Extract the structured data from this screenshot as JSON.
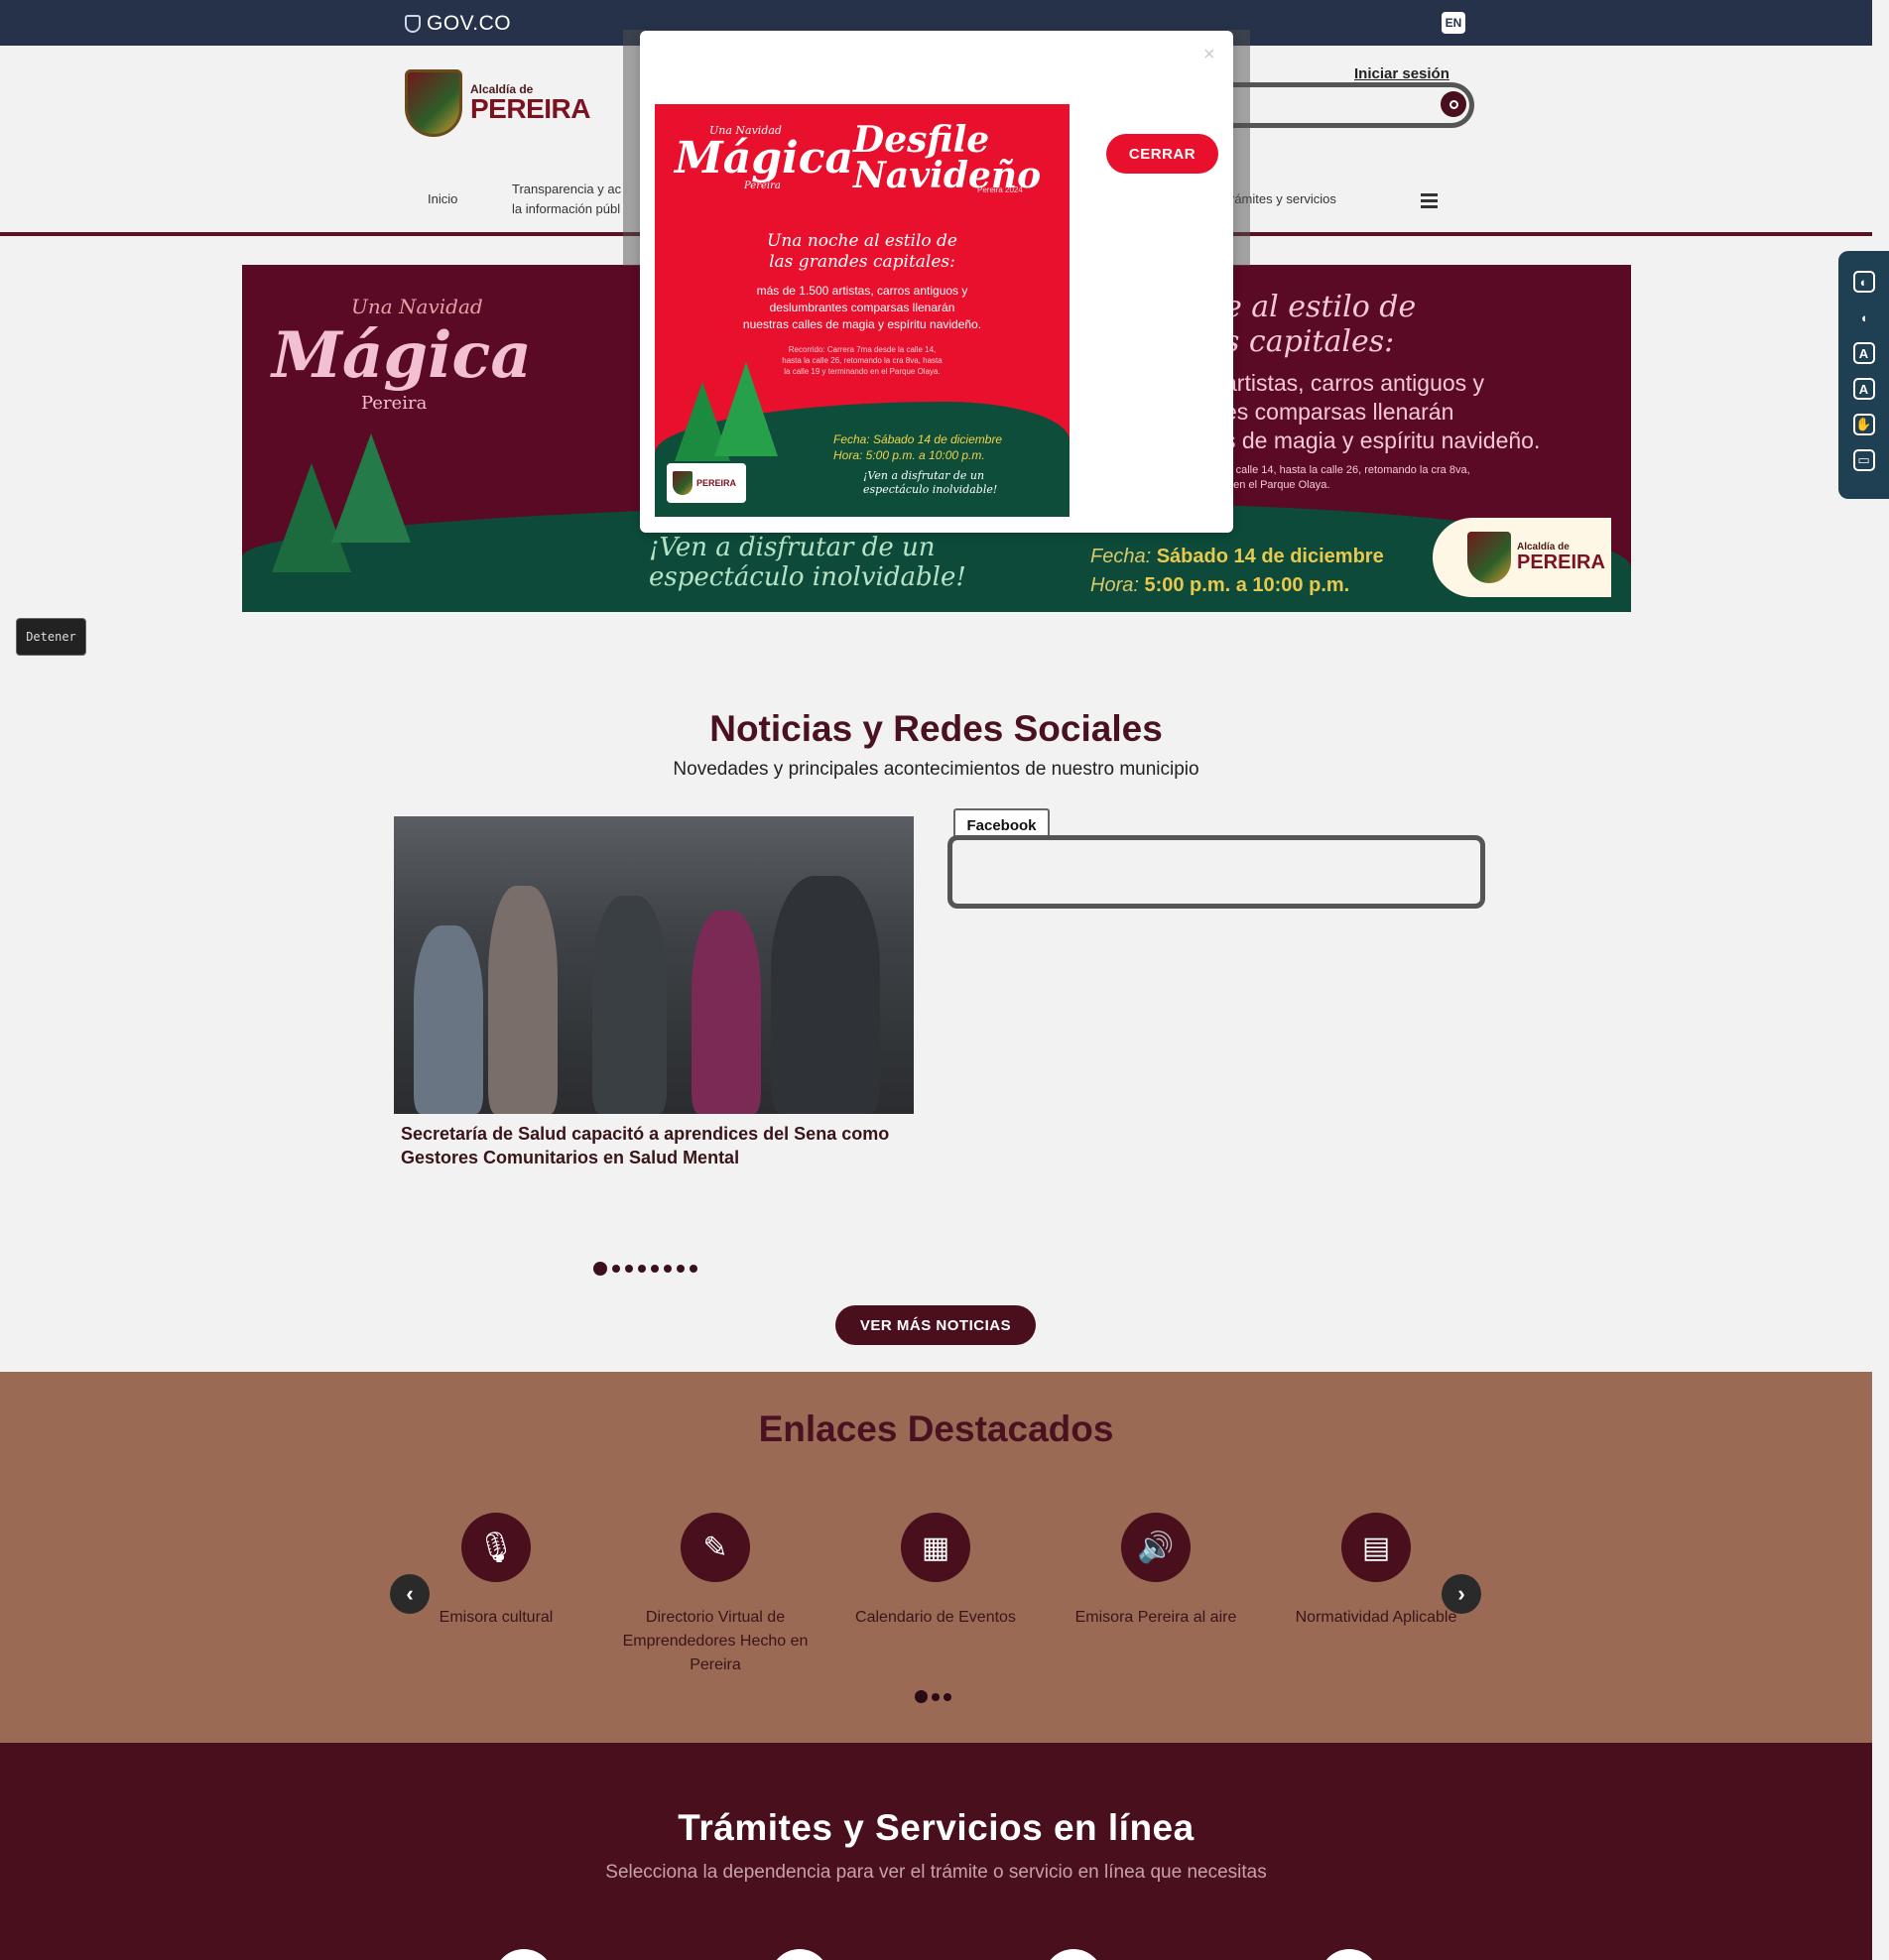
{
  "govbar": {
    "label": "GOV.CO",
    "lang": "EN"
  },
  "header": {
    "logo_small": "Alcaldía de",
    "logo_big": "PEREIRA",
    "login": "Iniciar sesión"
  },
  "nav": {
    "items": [
      "Inicio",
      "Transparencia y ac",
      "la información públ",
      "rámites y servicios"
    ]
  },
  "banner": {
    "magica_top": "Una Navidad",
    "magica_main": "Mágica",
    "magica_bottom": "Pereira",
    "headline": "e al estilo de",
    "headline2": "s capitales:",
    "body": [
      "artistas, carros antiguos y",
      "es comparsas llenarán",
      "s de magia y espíritu navideño."
    ],
    "route": [
      "la calle 14, hasta la calle 26, retomando la cra 8va,",
      "o en el Parque Olaya."
    ],
    "ven": [
      "¡Ven a disfrutar de un",
      "espectáculo inolvidable!"
    ],
    "fecha_label": "Fecha:",
    "fecha_value": "Sábado 14 de diciembre",
    "hora_label": "Hora:",
    "hora_value": "5:00 p.m. a 10:00 p.m.",
    "logo_small": "Alcaldía de",
    "logo_big": "PEREIRA"
  },
  "detener": "Detener",
  "modal": {
    "close_x": "×",
    "cerrar": "CERRAR",
    "poster": {
      "una_navidad": "Una Navidad",
      "magica": "Mágica",
      "pereira": "Pereira",
      "desfile": "Desfile",
      "navideno": "Navideño",
      "sub": "Pereira 2024",
      "noche": [
        "Una noche al estilo de",
        "las grandes capitales:"
      ],
      "body": [
        "más de 1.500 artistas, carros antiguos y",
        "deslumbrantes comparsas llenarán",
        "nuestras calles de magia y espíritu navideño."
      ],
      "route": [
        "Recorrido: Carrera 7ma desde la calle 14,",
        "hasta la calle 26, retomando la cra 8va, hasta",
        "la calle 19 y terminando en el Parque Olaya."
      ],
      "fecha": "Fecha: Sábado 14 de diciembre",
      "hora": "Hora: 5:00 p.m. a 10:00 p.m.",
      "ven": [
        "¡Ven a disfrutar de un",
        "espectáculo inolvidable!"
      ],
      "logo": "PEREIRA"
    }
  },
  "news": {
    "title": "Noticias y Redes Sociales",
    "subtitle": "Novedades y principales acontecimientos de nuestro municipio",
    "caption": "Secretaría de Salud capacitó a aprendices del Sena como Gestores Comunitarios en Salud Mental",
    "facebook_tab": "Facebook",
    "ver_mas": "VER MÁS NOTICIAS"
  },
  "enlaces": {
    "title": "Enlaces Destacados",
    "items": [
      {
        "label": "Emisora cultural",
        "icon": "microphone-icon"
      },
      {
        "label": "Directorio Virtual de Emprendedores Hecho en Pereira",
        "icon": "edit-icon"
      },
      {
        "label": "Calendario de Eventos",
        "icon": "calendar-icon"
      },
      {
        "label": "Emisora Pereira al aire",
        "icon": "volume-icon"
      },
      {
        "label": "Normatividad Aplicable",
        "icon": "book-icon"
      }
    ]
  },
  "tramites": {
    "title": "Trámites y Servicios en línea",
    "subtitle": "Selecciona la dependencia para ver el trámite o servicio en línea que necesitas"
  },
  "colors": {
    "primary": "#4a0f1c",
    "govbar": "#263249",
    "enlaces_bg": "#9b6a55",
    "cerrar": "#e8102c"
  }
}
